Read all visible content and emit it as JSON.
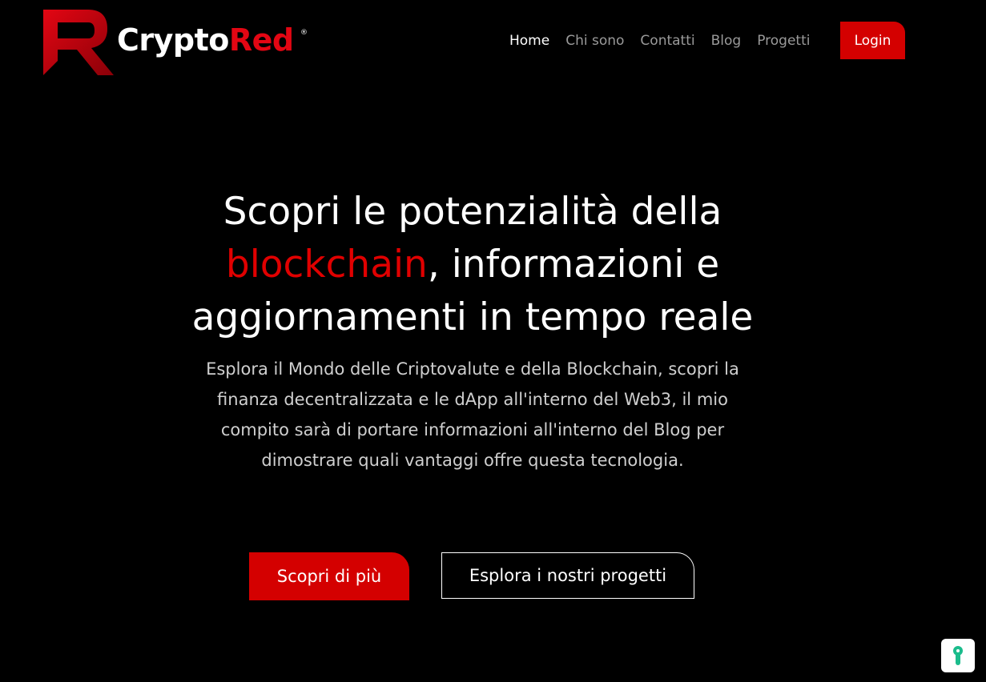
{
  "brand": {
    "name_part1": "Crypto",
    "name_part2": "Red",
    "registered_mark": "®",
    "accent_color": "#e30613"
  },
  "nav": {
    "items": [
      {
        "label": "Home",
        "active": true
      },
      {
        "label": "Chi sono",
        "active": false
      },
      {
        "label": "Contatti",
        "active": false
      },
      {
        "label": "Blog",
        "active": false
      },
      {
        "label": "Progetti",
        "active": false
      }
    ],
    "login_label": "Login"
  },
  "hero": {
    "title_part1": "Scopri le potenzialità della",
    "title_highlight": "blockchain",
    "title_part2": ", informazioni e aggiornamenti in tempo reale",
    "description": "Esplora il Mondo delle Criptovalute e della Blockchain, scopri la finanza decentralizzata e le dApp all'interno del Web3, il mio compito sarà di portare informazioni all'interno del Blog per dimostrare quali vantaggi offre questa tecnologia.",
    "primary_button": "Scopri di più",
    "secondary_button": "Esplora i nostri progetti"
  },
  "widgets": {
    "privacy_icon": "lock-icon"
  }
}
